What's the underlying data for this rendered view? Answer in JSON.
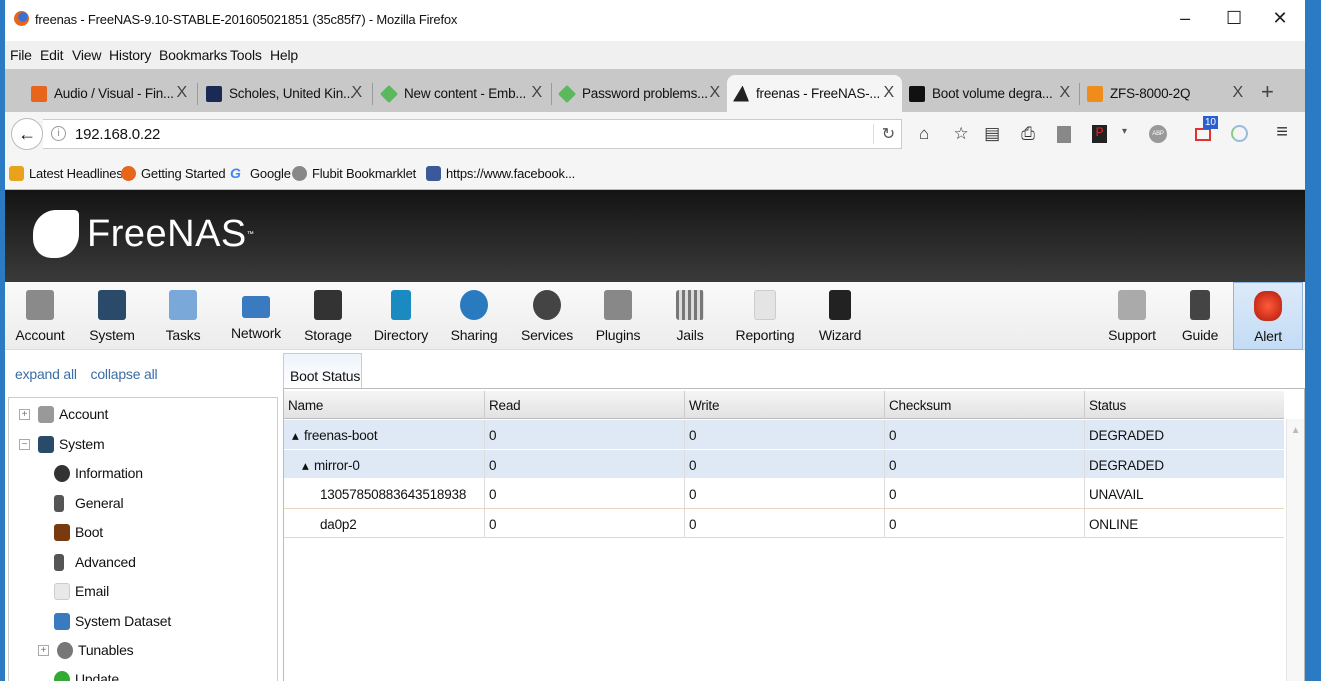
{
  "window": {
    "title": "freenas - FreeNAS-9.10-STABLE-201605021851 (35c85f7) - Mozilla Firefox",
    "minimize": "–",
    "maximize": "☐",
    "close": "✕"
  },
  "menu": [
    "File",
    "Edit",
    "View",
    "History",
    "Bookmarks",
    "Tools",
    "Help"
  ],
  "tabs": [
    {
      "label": "Audio / Visual - Fin...",
      "color": "#e8651c"
    },
    {
      "label": "Scholes, United Kin...",
      "color": "#1a2a55"
    },
    {
      "label": "New content - Emb...",
      "color": "#5cb85c"
    },
    {
      "label": "Password problems...",
      "color": "#5cb85c"
    },
    {
      "label": "freenas - FreeNAS-...",
      "color": "#222"
    },
    {
      "label": "Boot volume degra...",
      "color": "#111"
    },
    {
      "label": "ZFS-8000-2Q",
      "color": "#f08c1c"
    }
  ],
  "tab_close": "X",
  "new_tab": "+",
  "nav": {
    "back": "←",
    "url": "192.168.0.22",
    "reload": "↻",
    "mail_badge": "10",
    "abp": "ABP"
  },
  "bookmarks": [
    {
      "label": "Latest Headlines",
      "color": "#e8a21c"
    },
    {
      "label": "Getting Started",
      "color": "#e8651c"
    },
    {
      "label": "Google",
      "color": "#4285f4"
    },
    {
      "label": "Flubit Bookmarklet",
      "color": "#888"
    },
    {
      "label": "https://www.facebook...",
      "color": "#3b5998"
    }
  ],
  "app": {
    "logo": "FreeNAS",
    "tm": "™"
  },
  "toolbar": [
    {
      "label": "Account",
      "color": "#8a8a8a"
    },
    {
      "label": "System",
      "color": "#2a4a6a"
    },
    {
      "label": "Tasks",
      "color": "#7aa8d8"
    },
    {
      "label": "Network",
      "color": "#3a7ac0"
    },
    {
      "label": "Storage",
      "color": "#333"
    },
    {
      "label": "Directory",
      "color": "#1a8ac0"
    },
    {
      "label": "Sharing",
      "color": "#2a7ac0"
    },
    {
      "label": "Services",
      "color": "#444"
    },
    {
      "label": "Plugins",
      "color": "#888"
    },
    {
      "label": "Jails",
      "color": "#777"
    },
    {
      "label": "Reporting",
      "color": "#ddd"
    },
    {
      "label": "Wizard",
      "color": "#222"
    },
    {
      "label": "Support",
      "color": "#aaa"
    },
    {
      "label": "Guide",
      "color": "#444"
    },
    {
      "label": "Alert",
      "color": "#e0301c"
    }
  ],
  "sidebar": {
    "expand_all": "expand all",
    "collapse_all": "collapse all",
    "items": [
      {
        "label": "Account",
        "toggle": "+",
        "color": "#999"
      },
      {
        "label": "System",
        "toggle": "−",
        "color": "#2a4a6a"
      },
      {
        "label": "Information",
        "color": "#333"
      },
      {
        "label": "General",
        "color": "#555"
      },
      {
        "label": "Boot",
        "color": "#7a3a10"
      },
      {
        "label": "Advanced",
        "color": "#555"
      },
      {
        "label": "Email",
        "color": "#ddd"
      },
      {
        "label": "System Dataset",
        "color": "#3a7ac0"
      },
      {
        "label": "Tunables",
        "toggle": "+",
        "color": "#777"
      },
      {
        "label": "Update",
        "color": "#3a3"
      }
    ]
  },
  "content": {
    "tab": "Boot Status",
    "columns": [
      "Name",
      "Read",
      "Write",
      "Checksum",
      "Status"
    ],
    "rows": [
      {
        "name": "freenas-boot",
        "expander": "▴",
        "read": "0",
        "write": "0",
        "checksum": "0",
        "status": "DEGRADED"
      },
      {
        "name": "mirror-0",
        "expander": "▴",
        "read": "0",
        "write": "0",
        "checksum": "0",
        "status": "DEGRADED"
      },
      {
        "name": "13057850883643518938",
        "read": "0",
        "write": "0",
        "checksum": "0",
        "status": "UNAVAIL"
      },
      {
        "name": "da0p2",
        "read": "0",
        "write": "0",
        "checksum": "0",
        "status": "ONLINE"
      }
    ],
    "scroll_up": "▲"
  }
}
